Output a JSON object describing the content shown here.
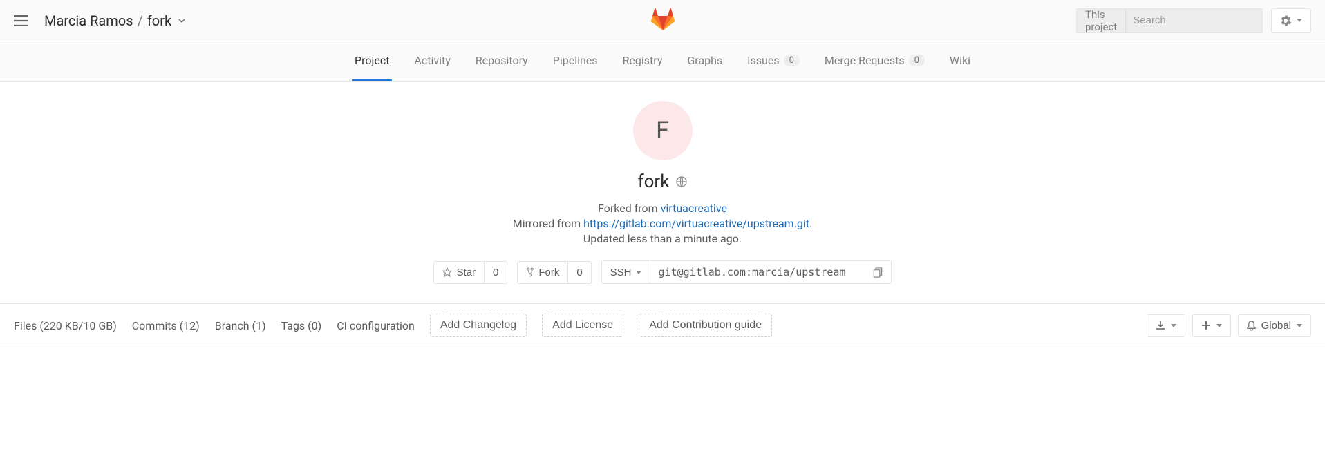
{
  "header": {
    "breadcrumb_owner": "Marcia Ramos",
    "breadcrumb_project": "fork",
    "search_scope": "This project",
    "search_placeholder": "Search"
  },
  "tabs": {
    "project": "Project",
    "activity": "Activity",
    "repository": "Repository",
    "pipelines": "Pipelines",
    "registry": "Registry",
    "graphs": "Graphs",
    "issues": "Issues",
    "issues_count": "0",
    "merge_requests": "Merge Requests",
    "mr_count": "0",
    "wiki": "Wiki"
  },
  "project": {
    "avatar_letter": "F",
    "name": "fork",
    "forked_prefix": "Forked from ",
    "forked_link": "virtuacreative",
    "mirrored_prefix": "Mirrored from ",
    "mirror_url": "https://gitlab.com/virtuacreative/upstream.git",
    "mirror_suffix": ".",
    "updated": "Updated less than a minute ago."
  },
  "actions": {
    "star": "Star",
    "star_count": "0",
    "fork": "Fork",
    "fork_count": "0",
    "protocol": "SSH",
    "clone_url": "git@gitlab.com:marcia/upstream"
  },
  "stats": {
    "files": "Files (220 KB/10 GB)",
    "commits": "Commits (12)",
    "branch": "Branch (1)",
    "tags": "Tags (0)",
    "ci": "CI configuration",
    "add_changelog": "Add Changelog",
    "add_license": "Add License",
    "add_contrib": "Add Contribution guide",
    "notification": "Global"
  }
}
